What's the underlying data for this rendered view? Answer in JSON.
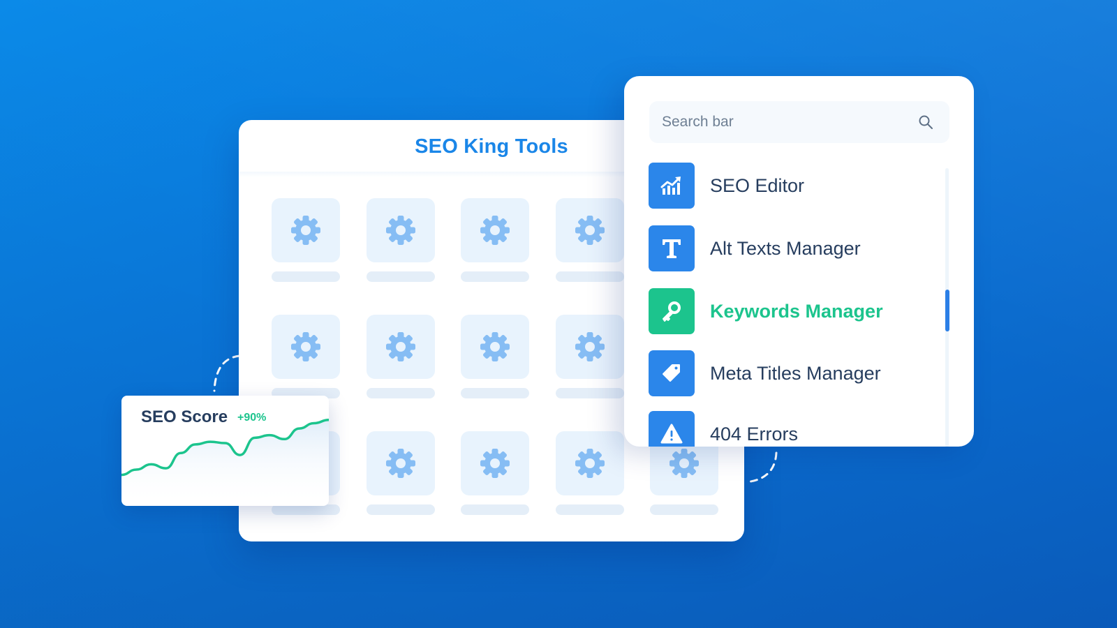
{
  "tools_panel": {
    "title": "SEO King Tools",
    "tile_icon": "gear-icon",
    "tile_rows": 3,
    "tile_cols": 5
  },
  "list_panel": {
    "search": {
      "placeholder": "Search bar",
      "icon": "search-icon"
    },
    "items": [
      {
        "label": "SEO Editor",
        "icon": "chart-growth-icon",
        "active": false
      },
      {
        "label": "Alt Texts Manager",
        "icon": "text-t-icon",
        "active": false
      },
      {
        "label": "Keywords Manager",
        "icon": "key-icon",
        "active": true
      },
      {
        "label": "Meta Titles Manager",
        "icon": "tag-icon",
        "active": false
      },
      {
        "label": "404 Errors",
        "icon": "warning-icon",
        "active": false
      }
    ],
    "scroll_position": 0.5
  },
  "score_card": {
    "title": "SEO Score",
    "delta": "+90%",
    "trend": [
      12,
      20,
      28,
      22,
      45,
      58,
      62,
      60,
      42,
      68,
      72,
      66,
      82,
      90,
      95
    ],
    "colors": {
      "line": "#1cc48d"
    }
  },
  "colors": {
    "accent_blue": "#1a86e8",
    "active_green": "#1cc48d",
    "item_icon_blue": "#2b86ea"
  }
}
